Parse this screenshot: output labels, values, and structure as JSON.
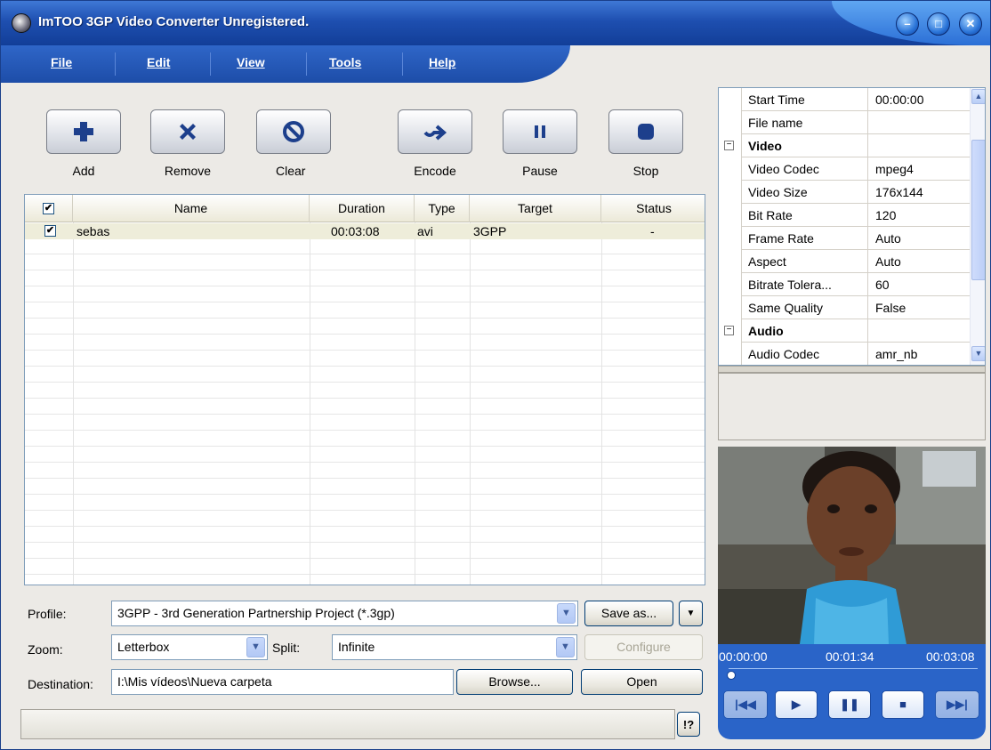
{
  "window": {
    "title": "ImTOO 3GP Video Converter Unregistered."
  },
  "menu": [
    {
      "label": "File"
    },
    {
      "label": "Edit"
    },
    {
      "label": "View"
    },
    {
      "label": "Tools"
    },
    {
      "label": "Help"
    }
  ],
  "toolbar": {
    "add": "Add",
    "remove": "Remove",
    "clear": "Clear",
    "encode": "Encode",
    "pause": "Pause",
    "stop": "Stop"
  },
  "grid": {
    "columns": [
      "Name",
      "Duration",
      "Type",
      "Target",
      "Status"
    ],
    "rows": [
      {
        "name": "sebas",
        "duration": "00:03:08",
        "type": "avi",
        "target": "3GPP",
        "status": "-"
      }
    ]
  },
  "form": {
    "profile_label": "Profile:",
    "profile_value": "3GPP - 3rd Generation Partnership Project  (*.3gp)",
    "save_as": "Save as...",
    "zoom_label": "Zoom:",
    "zoom_value": "Letterbox",
    "split_label": "Split:",
    "split_value": "Infinite",
    "configure": "Configure",
    "destination_label": "Destination:",
    "destination_value": "I:\\Mis vídeos\\Nueva carpeta",
    "browse": "Browse...",
    "open": "Open"
  },
  "status": {
    "help_button": "!?"
  },
  "properties": {
    "rows": [
      {
        "name": "Start Time",
        "value": "00:00:00"
      },
      {
        "name": "File name",
        "value": ""
      },
      {
        "name": "Video",
        "value": ""
      },
      {
        "name": "Video Codec",
        "value": "mpeg4"
      },
      {
        "name": "Video Size",
        "value": "176x144"
      },
      {
        "name": "Bit Rate",
        "value": "120"
      },
      {
        "name": "Frame Rate",
        "value": "Auto"
      },
      {
        "name": "Aspect",
        "value": "Auto"
      },
      {
        "name": "Bitrate Tolera...",
        "value": "60"
      },
      {
        "name": "Same Quality",
        "value": "False"
      },
      {
        "name": "Audio",
        "value": ""
      },
      {
        "name": "Audio Codec",
        "value": "amr_nb"
      }
    ]
  },
  "player": {
    "time_start": "00:00:00",
    "time_mid": "00:01:34",
    "time_end": "00:03:08",
    "position_fraction": 0.0
  },
  "colors": {
    "titlebar": "#1e4fb0",
    "accent": "#2a64c8",
    "row_highlight": "#eeedda"
  }
}
